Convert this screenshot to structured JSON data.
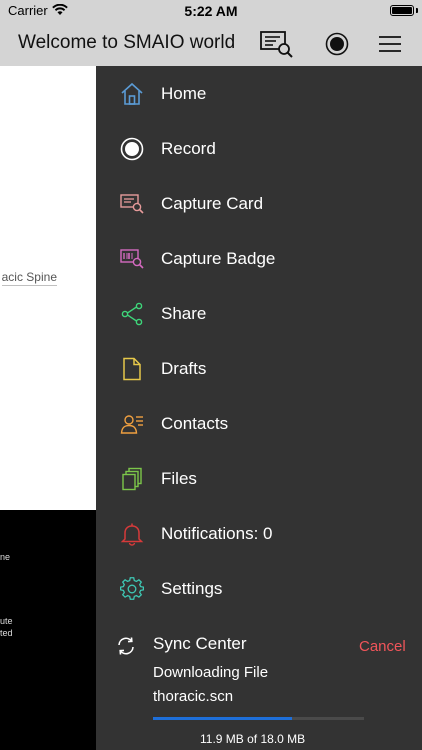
{
  "status_bar": {
    "carrier": "Carrier",
    "time": "5:22 AM"
  },
  "nav": {
    "title": "Welcome to SMAIO world"
  },
  "background": {
    "link_text": "acic Spine",
    "fragments": [
      "ne",
      "ute",
      "ted"
    ]
  },
  "menu": {
    "items": [
      {
        "label": "Home",
        "icon": "home-icon",
        "color": "#5b9bd5"
      },
      {
        "label": "Record",
        "icon": "record-icon",
        "color": "#ffffff"
      },
      {
        "label": "Capture Card",
        "icon": "capture-card-icon",
        "color": "#e79b9b"
      },
      {
        "label": "Capture Badge",
        "icon": "capture-badge-icon",
        "color": "#d56ac0"
      },
      {
        "label": "Share",
        "icon": "share-icon",
        "color": "#3ed67a"
      },
      {
        "label": "Drafts",
        "icon": "drafts-icon",
        "color": "#e6c84a"
      },
      {
        "label": "Contacts",
        "icon": "contacts-icon",
        "color": "#f0a040"
      },
      {
        "label": "Files",
        "icon": "files-icon",
        "color": "#7cc64a"
      },
      {
        "label": "Notifications: 0",
        "icon": "bell-icon",
        "color": "#d63a3a"
      },
      {
        "label": "Settings",
        "icon": "gear-icon",
        "color": "#3ec8b4"
      }
    ]
  },
  "sync": {
    "title": "Sync Center",
    "cancel": "Cancel",
    "status": "Downloading File",
    "filename": "thoracic.scn",
    "progress": 0.66,
    "size_text": "11.9 MB of 18.0 MB"
  },
  "colors": {
    "drawer_bg": "#333333",
    "nav_bg": "#d4d4d4",
    "accent_cancel": "#f0555a",
    "progress": "#1e6fd9"
  }
}
